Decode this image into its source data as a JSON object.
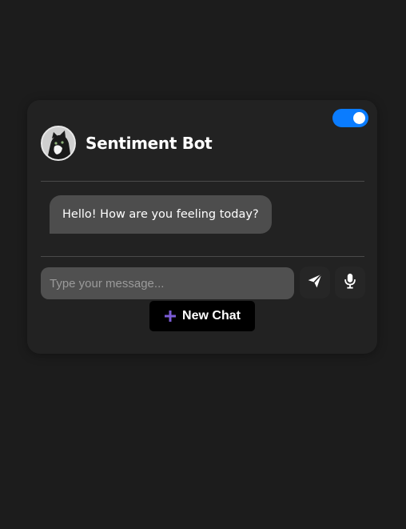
{
  "chat": {
    "bot_name": "Sentiment Bot",
    "messages": [
      {
        "sender": "bot",
        "text": "Hello! How are you feeling today?"
      }
    ],
    "input_placeholder": "Type your message...",
    "new_chat_label": "New Chat",
    "toggle_on": true
  },
  "icons": {
    "send": "paper-plane-icon",
    "mic": "microphone-icon",
    "plus": "plus-icon",
    "avatar": "cat-photo-avatar"
  },
  "colors": {
    "page_bg": "#1c1c1c",
    "card_bg": "#222222",
    "toggle_accent": "#0a7cff",
    "bubble_bg": "#4d4d4d",
    "input_bg": "#505050",
    "plus_accent": "#7b5cd6"
  }
}
